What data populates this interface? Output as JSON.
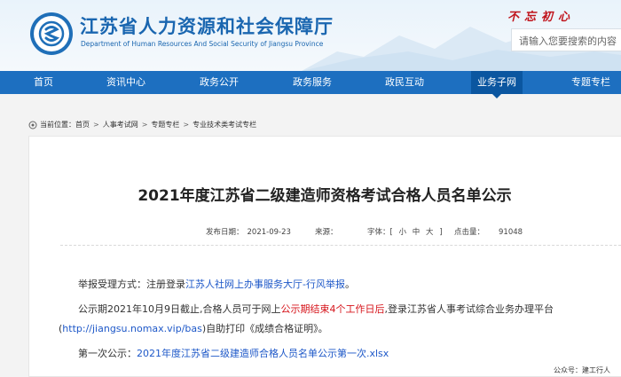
{
  "header": {
    "title": "江苏省人力资源和社会保障厅",
    "subtitle": "Department of Human Resources And Social Security of Jiangsu Province",
    "slogan": "不忘初心",
    "search_placeholder": "请输入您要搜索的内容"
  },
  "nav": {
    "items": [
      "首页",
      "资讯中心",
      "政务公开",
      "政务服务",
      "政民互动",
      "业务子网",
      "专题专栏"
    ],
    "active_index": 5
  },
  "breadcrumb": {
    "prefix": "当前位置：",
    "items": [
      "首页",
      "人事考试网",
      "专题专栏",
      "专业技术类考试专栏"
    ],
    "separator": ">"
  },
  "article": {
    "title": "2021年度江苏省二级建造师资格考试合格人员名单公示",
    "date_label": "发布日期：",
    "date": "2021-09-23",
    "source_label": "来源：",
    "source": "",
    "font_label": "字体：[",
    "font_small": "小",
    "font_medium": "中",
    "font_large": "大",
    "font_close": "]",
    "hits_label": "点击量：",
    "hits": "91048"
  },
  "body": {
    "p1_prefix": "举报受理方式：注册登录",
    "p1_link": "江苏人社网上办事服务大厅-行风举报",
    "p1_suffix": "。",
    "p2_prefix": "公示期2021年10月9日截止,合格人员可于网上",
    "p2_highlight": "公示期结束4个工作日后",
    "p2_suffix": ",登录江苏省人事考试综合业务办理平台",
    "p3_open": "(",
    "p3_link": "http://jiangsu.nomax.vip/bas",
    "p3_suffix": ")自助打印《成绩合格证明》。",
    "p4_prefix": "第一次公示：",
    "p4_link": "2021年度江苏省二级建造师合格人员名单公示第一次.xlsx"
  },
  "footer_note": "公众号：建工行人",
  "colors": {
    "nav_bg": "#1d6fc0",
    "brand_blue": "#1a66b0",
    "link_blue": "#1e58c8",
    "highlight_red": "#d6141b",
    "slogan_red": "#c0141c"
  }
}
